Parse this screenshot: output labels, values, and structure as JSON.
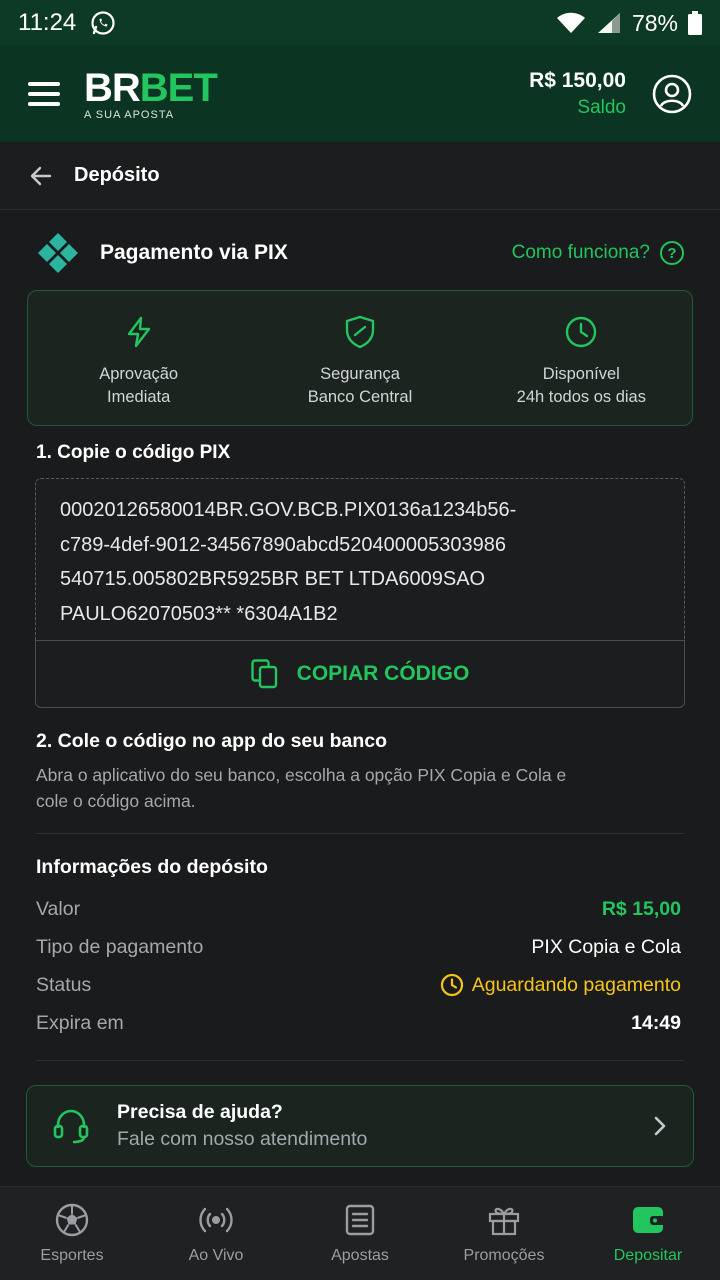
{
  "status_bar": {
    "time": "11:24",
    "battery": "78%"
  },
  "header": {
    "logo_br": "BR",
    "logo_bet": "BET",
    "logo_tagline": "A SUA APOSTA",
    "balance_amount": "R$ 150,00",
    "balance_label": "Saldo"
  },
  "page": {
    "title": "Depósito"
  },
  "pix": {
    "title": "Pagamento via PIX",
    "how_it_works": "Como funciona?",
    "help_glyph": "?",
    "features": [
      {
        "icon": "lightning-icon",
        "line1": "Aprovação",
        "line2": "Imediata"
      },
      {
        "icon": "shield-icon",
        "line1": "Segurança",
        "line2": "Banco Central"
      },
      {
        "icon": "clock-icon",
        "line1": "Disponível",
        "line2": "24h todos os dias"
      }
    ],
    "step1_title": "1. Copie o código PIX",
    "code_lines": [
      "00020126580014BR.GOV.BCB.PIX0136a1234b56-",
      "c789-4def-9012-34567890abcd520400005303986",
      "540715.005802BR5925BR BET LTDA6009SAO",
      "PAULO62070503** *6304A1B2"
    ],
    "copy_button": "COPIAR CÓDIGO",
    "step2_title": "2. Cole o código no app do seu banco",
    "step2_desc": "Abra o aplicativo do seu banco, escolha a opção PIX Copia e Cola e cole o código acima."
  },
  "deposit_info": {
    "title": "Informações do depósito",
    "rows": [
      {
        "label": "Valor",
        "value": "R$ 15,00"
      },
      {
        "label": "Tipo de pagamento",
        "value": "PIX Copia e Cola"
      },
      {
        "label": "Status",
        "value": "Aguardando pagamento"
      },
      {
        "label": "Expira em",
        "value": "14:49"
      }
    ]
  },
  "help": {
    "title": "Precisa de ajuda?",
    "subtitle": "Fale com nosso atendimento"
  },
  "bottom_nav": [
    {
      "label": "Esportes",
      "icon": "soccer-ball-icon"
    },
    {
      "label": "Ao Vivo",
      "icon": "live-broadcast-icon"
    },
    {
      "label": "Apostas",
      "icon": "bet-slip-icon"
    },
    {
      "label": "Promoções",
      "icon": "gift-icon"
    },
    {
      "label": "Depositar",
      "icon": "wallet-icon",
      "active": true
    }
  ],
  "colors": {
    "accent": "#22c55e",
    "header_bg": "#0b3522",
    "page_bg": "#1a1b1c",
    "pending": "#f5c518"
  }
}
